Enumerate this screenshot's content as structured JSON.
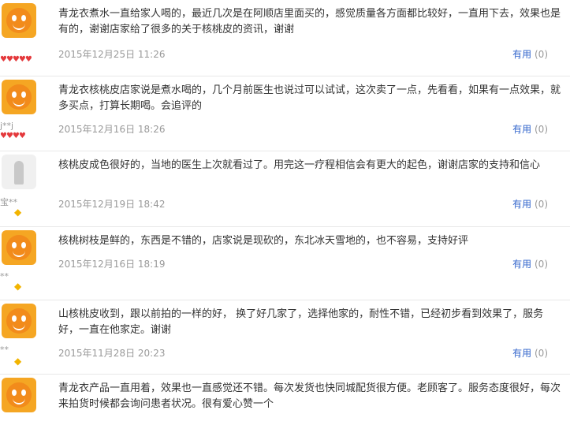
{
  "reviews": [
    {
      "avatar": "orange-mascot",
      "rank": "♥♥♥♥♥",
      "rank_kind": "hearts",
      "content": "青龙衣煮水一直给家人喝的，最近几次是在阿顺店里面买的，感觉质量各方面都比较好，一直用下去，效果也是有的，谢谢店家给了很多的关于核桃皮的资讯，谢谢",
      "date": "2015年12月25日 11:26",
      "useful_label": "有用",
      "useful_count": "(0)"
    },
    {
      "avatar": "orange-mascot",
      "nick": "j**j",
      "rank": "♥♥♥♥",
      "rank_kind": "hearts",
      "content": "青龙衣核桃皮店家说是煮水喝的，几个月前医生也说过可以试试，这次卖了一点，先看看，如果有一点效果，就多买点，打算长期喝。会追评的",
      "date": "2015年12月16日 18:26",
      "useful_label": "有用",
      "useful_count": "(0)"
    },
    {
      "avatar": "photo",
      "nick": "宝**",
      "rank": "◆",
      "rank_kind": "diamond",
      "content": "核桃皮成色很好的，当地的医生上次就看过了。用完这一疗程相信会有更大的起色，谢谢店家的支持和信心",
      "date": "2015年12月19日 18:42",
      "useful_label": "有用",
      "useful_count": "(0)"
    },
    {
      "avatar": "orange-mascot",
      "nick": "**",
      "rank": "◆",
      "rank_kind": "diamond",
      "content": "核桃树枝是鲜的，东西是不错的，店家说是现砍的，东北冰天雪地的，也不容易，支持好评",
      "date": "2015年12月16日 18:19",
      "useful_label": "有用",
      "useful_count": "(0)"
    },
    {
      "avatar": "orange-mascot",
      "nick": "**",
      "rank": "◆",
      "rank_kind": "diamond",
      "content": "山核桃皮收到，跟以前拍的一样的好， 换了好几家了，选择他家的，耐性不错，已经初步看到效果了，服务 好，一直在他家定。谢谢",
      "date": "2015年11月28日 20:23",
      "useful_label": "有用",
      "useful_count": "(0)"
    },
    {
      "avatar": "orange-mascot",
      "nick": "",
      "rank": "",
      "rank_kind": "none",
      "content": "青龙衣产品一直用着，效果也一直感觉还不错。每次发货也快同城配货很方便。老顾客了。服务态度很好，每次来拍货时候都会询问患者状况。很有爱心赞一个",
      "date": "",
      "useful_label": "",
      "useful_count": ""
    }
  ]
}
